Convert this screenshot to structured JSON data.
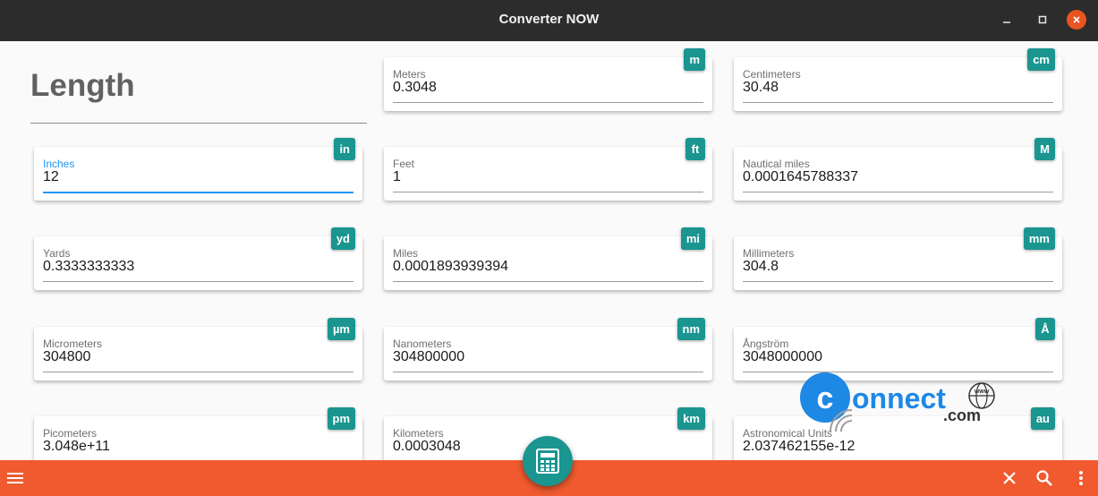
{
  "window": {
    "title": "Converter NOW"
  },
  "page": {
    "heading": "Length"
  },
  "units": [
    {
      "label": "Meters",
      "value": "0.3048",
      "symbol": "m"
    },
    {
      "label": "Centimeters",
      "value": "30.48",
      "symbol": "cm"
    },
    {
      "label": "Inches",
      "value": "12",
      "symbol": "in"
    },
    {
      "label": "Feet",
      "value": "1",
      "symbol": "ft"
    },
    {
      "label": "Nautical miles",
      "value": "0.0001645788337",
      "symbol": "M"
    },
    {
      "label": "Yards",
      "value": "0.3333333333",
      "symbol": "yd"
    },
    {
      "label": "Miles",
      "value": "0.0001893939394",
      "symbol": "mi"
    },
    {
      "label": "Millimeters",
      "value": "304.8",
      "symbol": "mm"
    },
    {
      "label": "Micrometers",
      "value": "304800",
      "symbol": "µm"
    },
    {
      "label": "Nanometers",
      "value": "304800000",
      "symbol": "nm"
    },
    {
      "label": "Ångström",
      "value": "3048000000",
      "symbol": "Å"
    },
    {
      "label": "Picometers",
      "value": "3.048e+11",
      "symbol": "pm"
    },
    {
      "label": "Kilometers",
      "value": "0.0003048",
      "symbol": "km"
    },
    {
      "label": "Astronomical Units",
      "value": "2.037462155e-12",
      "symbol": "au"
    }
  ],
  "active_unit": "Inches",
  "watermark": {
    "text_main": "onnect",
    "text_sub": ".com",
    "www": "www"
  },
  "icons": {
    "menu": "hamburger-menu-icon",
    "clear": "close-icon",
    "search": "search-icon",
    "more": "more-vert-icon",
    "fab": "calculator-icon"
  },
  "colors": {
    "accent": "#1a9590",
    "bottom_bar": "#f05a2e",
    "title_bar": "#2c2c2c",
    "focus": "#2196f3",
    "close_button": "#e95420"
  }
}
